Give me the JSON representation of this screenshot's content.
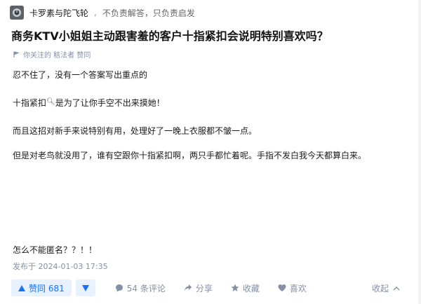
{
  "author": {
    "name": "卡罗素与陀飞轮",
    "bio": "不负责解答，只负责启发"
  },
  "question": {
    "title": "商务KTV小姐姐主动跟害羞的客户十指紧扣会说明特别喜欢吗？"
  },
  "meta": {
    "text": "你关注的 秸法者 赞同"
  },
  "answer": {
    "p1": "忍不住了，没有一个答案写出重点的",
    "p2_a": "十指紧扣",
    "p2_b": "是为了让你手空不出来摸她！",
    "p3": "而且这招对新手来说特别有用，处理好了一晚上衣服都不皱一点。",
    "p4": "但是对老鸟就没用了，谁有空跟你十指紧扣啊，两只手都忙着呢。手指不发白我今天都算白来。",
    "p5": "怎么不能匿名？？！！"
  },
  "publish": {
    "time": "发布于 2024-01-03 17:35"
  },
  "actions": {
    "vote_up": "赞同 681",
    "comments": "54 条评论",
    "share": "分享",
    "favorite": "收藏",
    "like": "喜欢",
    "collapse": "收起"
  },
  "colors": {
    "accent": "#1772f6",
    "accent_bg": "#e8f1ff",
    "muted": "#8590a6"
  },
  "icons": [
    "avatar",
    "flag-icon",
    "search-icon",
    "triangle-up-icon",
    "triangle-down-icon",
    "comment-icon",
    "share-icon",
    "star-icon",
    "heart-icon",
    "chevron-up-icon"
  ]
}
